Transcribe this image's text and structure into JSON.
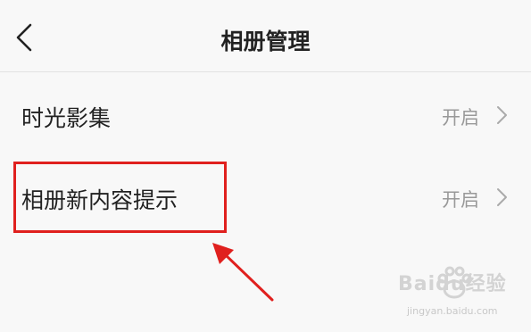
{
  "header": {
    "title": "相册管理",
    "back_icon": "chevron-left-icon"
  },
  "settings": [
    {
      "label": "时光影集",
      "value": "开启"
    },
    {
      "label": "相册新内容提示",
      "value": "开启"
    }
  ],
  "annotation": {
    "color": "#e0201e",
    "highlighted_item": "相册新内容提示"
  },
  "watermark": {
    "brand": "Baidu经验",
    "url": "jingyan.baidu.com"
  }
}
